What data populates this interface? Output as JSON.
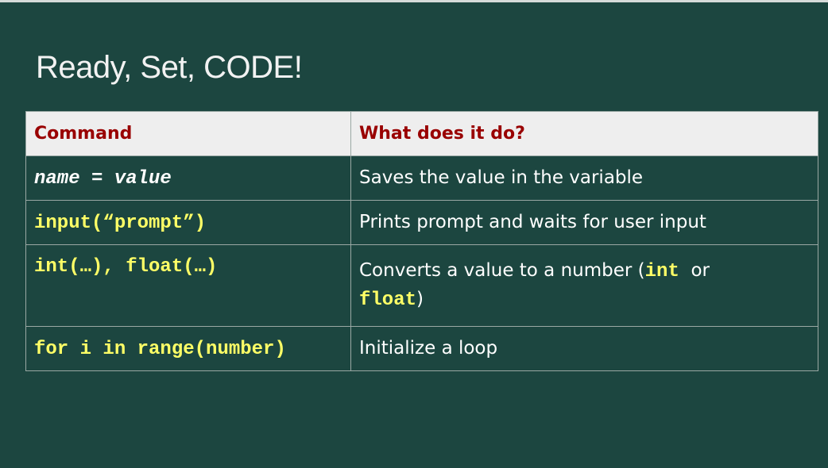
{
  "title": "Ready, Set, CODE!",
  "colors": {
    "background": "#1c4640",
    "header_bg": "#eeeeee",
    "header_text": "#990000",
    "code_text": "#ffff66",
    "body_text": "#ffffff"
  },
  "table": {
    "headers": [
      "Command",
      "What does it do?"
    ],
    "rows": [
      {
        "command": "name = value",
        "description": "Saves the value in the variable"
      },
      {
        "command": "input(“prompt”)",
        "description": "Prints prompt and waits for user input"
      },
      {
        "command": "int(…), float(…)",
        "description_prefix": "Converts a value to a number (",
        "description_code1": "int",
        "description_mid": "  or ",
        "description_code2": "float",
        "description_suffix": ")"
      },
      {
        "command": "for i in range(number)",
        "description": "Initialize a loop"
      }
    ]
  }
}
